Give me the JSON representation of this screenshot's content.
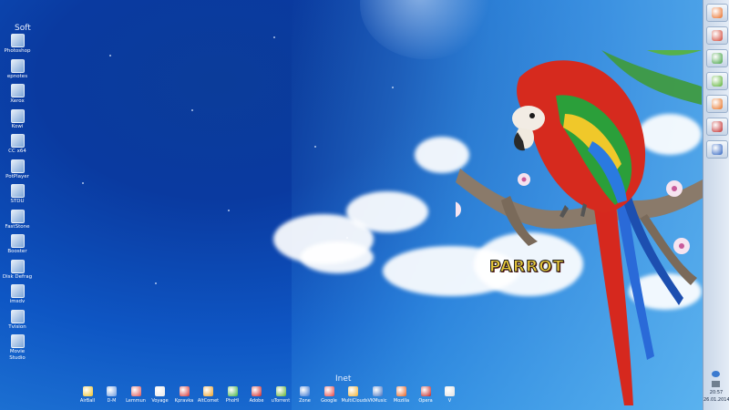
{
  "desktop": {
    "group_title": "Soft",
    "icons": [
      {
        "label": "Photoshop",
        "icon": "photoshop-icon"
      },
      {
        "label": "epnotes",
        "icon": "notes-icon"
      },
      {
        "label": "Xerox",
        "icon": "xerox-icon"
      },
      {
        "label": "Kowi",
        "icon": "kowi-icon"
      },
      {
        "label": "CC x64",
        "icon": "ccleaner-icon"
      },
      {
        "label": "PotPlayer",
        "icon": "potplayer-icon"
      },
      {
        "label": "STDU",
        "icon": "stdu-icon"
      },
      {
        "label": "FastStone",
        "icon": "faststone-icon"
      },
      {
        "label": "Booster",
        "icon": "booster-icon"
      },
      {
        "label": "Disk Defrag",
        "icon": "defrag-icon"
      },
      {
        "label": "imsdv",
        "icon": "imsdv-icon"
      },
      {
        "label": "Tvision",
        "icon": "tvision-icon"
      },
      {
        "label": "Movie Studio",
        "icon": "movie-studio-icon"
      }
    ]
  },
  "dock": {
    "title": "Inet",
    "items": [
      {
        "label": "AirBall",
        "color": "#f0c020"
      },
      {
        "label": "D-M",
        "color": "#6a9adf"
      },
      {
        "label": "Lemmun",
        "color": "#e05050"
      },
      {
        "label": "Voyage",
        "color": "#e8e8e8"
      },
      {
        "label": "Kpravka",
        "color": "#d83030"
      },
      {
        "label": "AltComet",
        "color": "#f0a020"
      },
      {
        "label": "PhoHl",
        "color": "#40b040"
      },
      {
        "label": "Adobe",
        "color": "#d02020"
      },
      {
        "label": "uTorrent",
        "color": "#60b030"
      },
      {
        "label": "Zone",
        "color": "#3070d0"
      },
      {
        "label": "Google",
        "color": "#e84040"
      },
      {
        "label": "MultiClouds",
        "color": "#f0b030"
      },
      {
        "label": "VKMusic",
        "color": "#4070c0"
      },
      {
        "label": "Mozilla",
        "color": "#e86020"
      },
      {
        "label": "Opera",
        "color": "#c02020"
      },
      {
        "label": "V",
        "color": "#e0e0e0"
      }
    ]
  },
  "wallpaper": {
    "text": "PARROT"
  },
  "taskbar": {
    "buttons": [
      {
        "icon": "firefox-icon",
        "color": "#e86a20"
      },
      {
        "icon": "text-editor-icon",
        "color": "#d04030"
      },
      {
        "icon": "file-manager-icon",
        "color": "#40a040"
      },
      {
        "icon": "utorrent-icon",
        "color": "#58b030"
      },
      {
        "icon": "mozilla-icon",
        "color": "#e87020"
      },
      {
        "icon": "opera-icon",
        "color": "#c02828"
      },
      {
        "icon": "download-icon",
        "color": "#2a60c0"
      }
    ],
    "clock_time": "20:57",
    "clock_date": "26.01.2014"
  },
  "colors": {
    "sky_dark": "#0a3aa0",
    "sky_light": "#6cc0f0",
    "taskbar": "#d8e2ee"
  }
}
